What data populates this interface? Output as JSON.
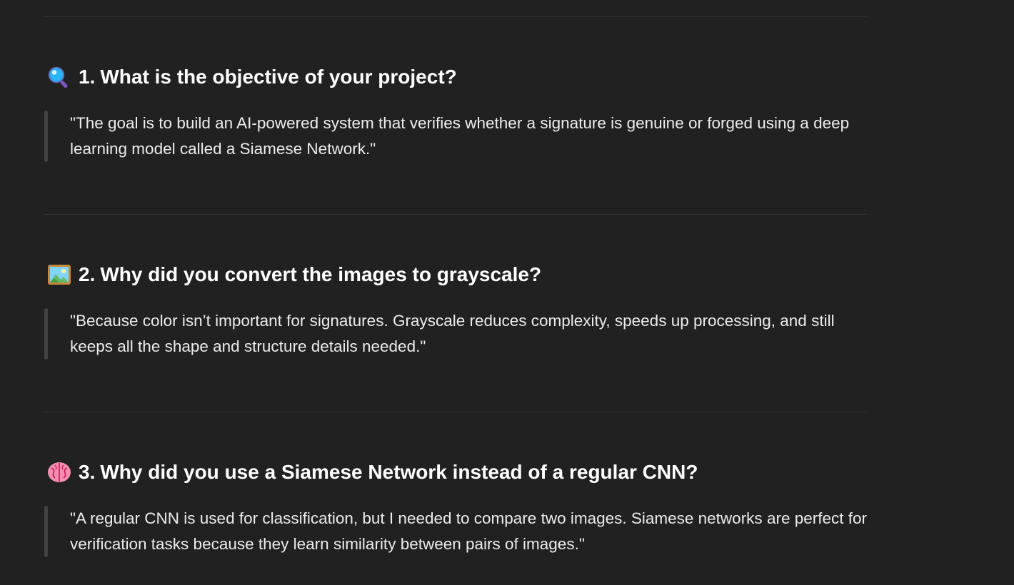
{
  "sections": [
    {
      "icon": "magnifying-glass-icon",
      "number": "1.",
      "title": "What is the objective of your project?",
      "answer": "\"The goal is to build an AI-powered system that verifies whether a signature is genuine or forged using a deep learning model called a Siamese Network.\""
    },
    {
      "icon": "framed-picture-icon",
      "number": "2.",
      "title": "Why did you convert the images to grayscale?",
      "answer": "\"Because color isn’t important for signatures. Grayscale reduces complexity, speeds up processing, and still keeps all the shape and structure details needed.\""
    },
    {
      "icon": "brain-icon",
      "number": "3.",
      "title": "Why did you use a Siamese Network instead of a regular CNN?",
      "answer": "\"A regular CNN is used for classification, but I needed to compare two images. Siamese networks are perfect for verification tasks because they learn similarity between pairs of images.\""
    }
  ],
  "colors": {
    "background": "#212121",
    "heading": "#ffffff",
    "text": "#ececec",
    "divider": "#333333",
    "quote_bar": "#424242"
  }
}
